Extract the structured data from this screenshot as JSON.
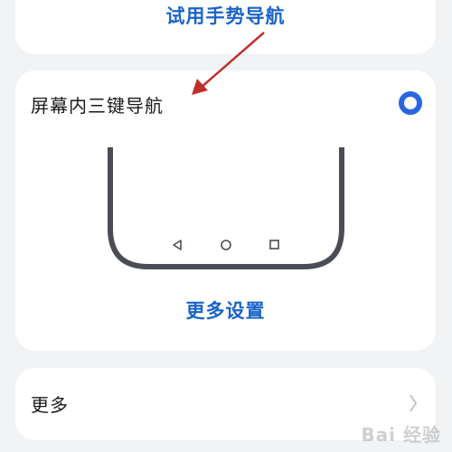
{
  "top_card": {
    "gesture_link": "试用手势导航"
  },
  "nav_option": {
    "title": "屏幕内三键导航",
    "selected": true,
    "more_settings": "更多设置",
    "buttons": [
      "back-icon",
      "home-icon",
      "recent-apps-icon"
    ]
  },
  "more_card": {
    "title": "更多"
  },
  "colors": {
    "accent": "#1a64c8",
    "radio": "#2a66e0",
    "arrow": "#c0302a",
    "phone": "#4a4d55"
  },
  "watermark": "Bai 经验"
}
